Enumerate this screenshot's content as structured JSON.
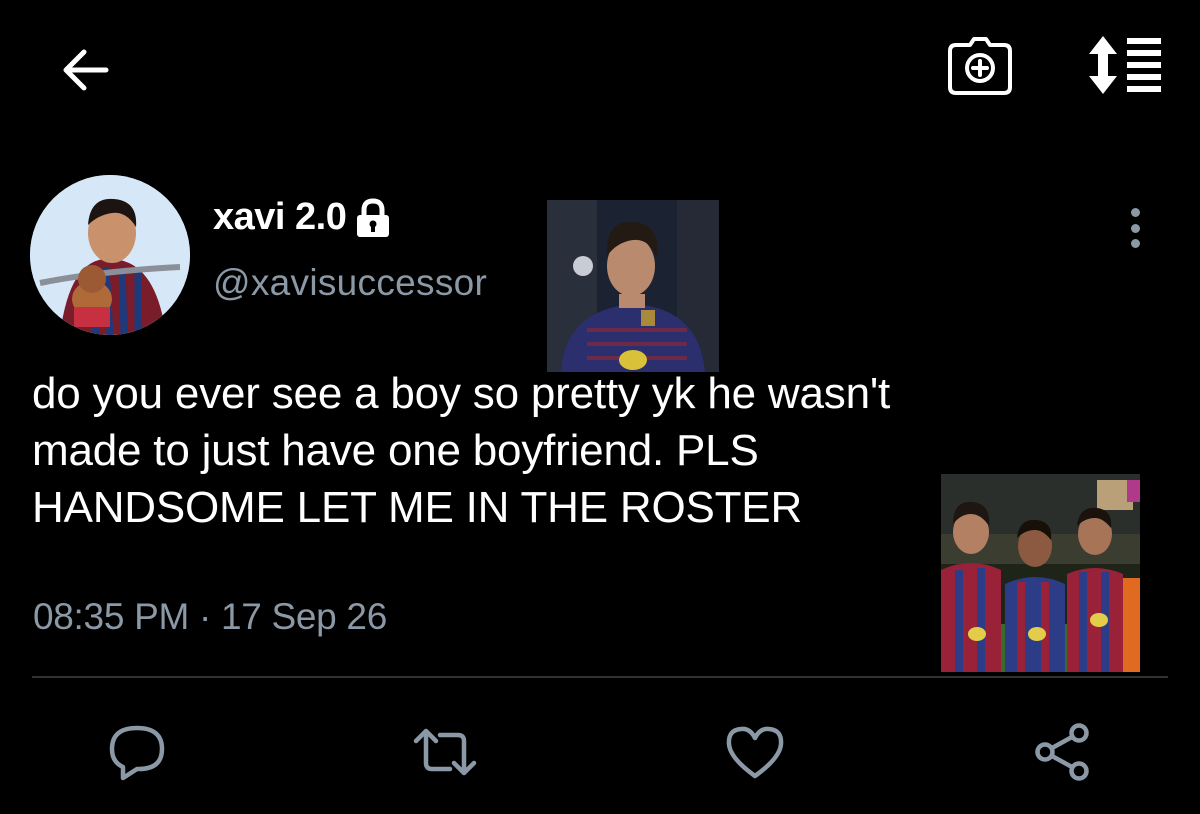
{
  "header": {
    "back_icon": "arrow-left-icon",
    "camera_icon": "camera-add-icon",
    "sort_icon": "sort-list-icon"
  },
  "tweet": {
    "display_name": "xavi 2.0",
    "protected_icon": "lock-icon",
    "handle": "@xavisuccessor",
    "text_lines": [
      "do you ever see a boy so pretty yk he wasn't",
      "made to just have one boyfriend. PLS",
      "HANDSOME LET ME IN THE ROSTER"
    ],
    "time": "08:35 PM",
    "separator": " · ",
    "date": "17 Sep 26"
  },
  "actions": {
    "reply_icon": "comment-icon",
    "retweet_icon": "retweet-icon",
    "like_icon": "heart-icon",
    "share_icon": "share-icon"
  },
  "colors": {
    "background": "#000000",
    "primary_text": "#ffffff",
    "secondary_text": "#8b98a5",
    "divider": "#2f3336"
  }
}
